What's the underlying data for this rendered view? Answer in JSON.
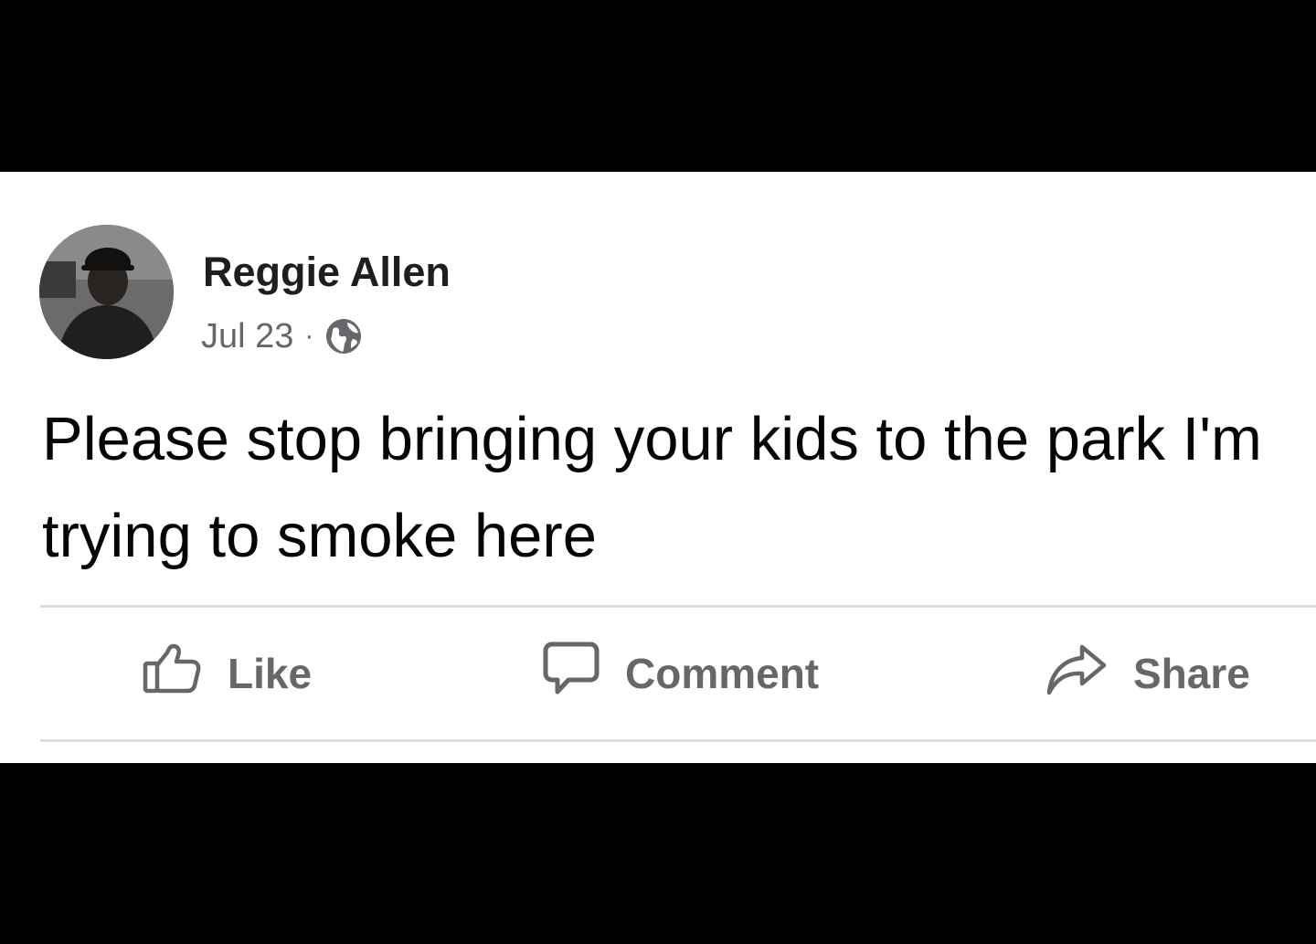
{
  "post": {
    "author_name": "Reggie Allen",
    "date": "Jul 23",
    "separator": "·",
    "audience_icon": "globe-icon",
    "text": "Please stop bringing your kids to the park I'm trying to smoke here"
  },
  "actions": {
    "like_label": "Like",
    "like_icon": "thumbs-up-icon",
    "comment_label": "Comment",
    "comment_icon": "speech-bubble-icon",
    "share_label": "Share",
    "share_icon": "share-arrow-icon"
  },
  "colors": {
    "background": "#ffffff",
    "letterbox": "#000000",
    "name_text": "#1c1e21",
    "secondary_text": "#65676b",
    "divider": "#dadde1"
  }
}
